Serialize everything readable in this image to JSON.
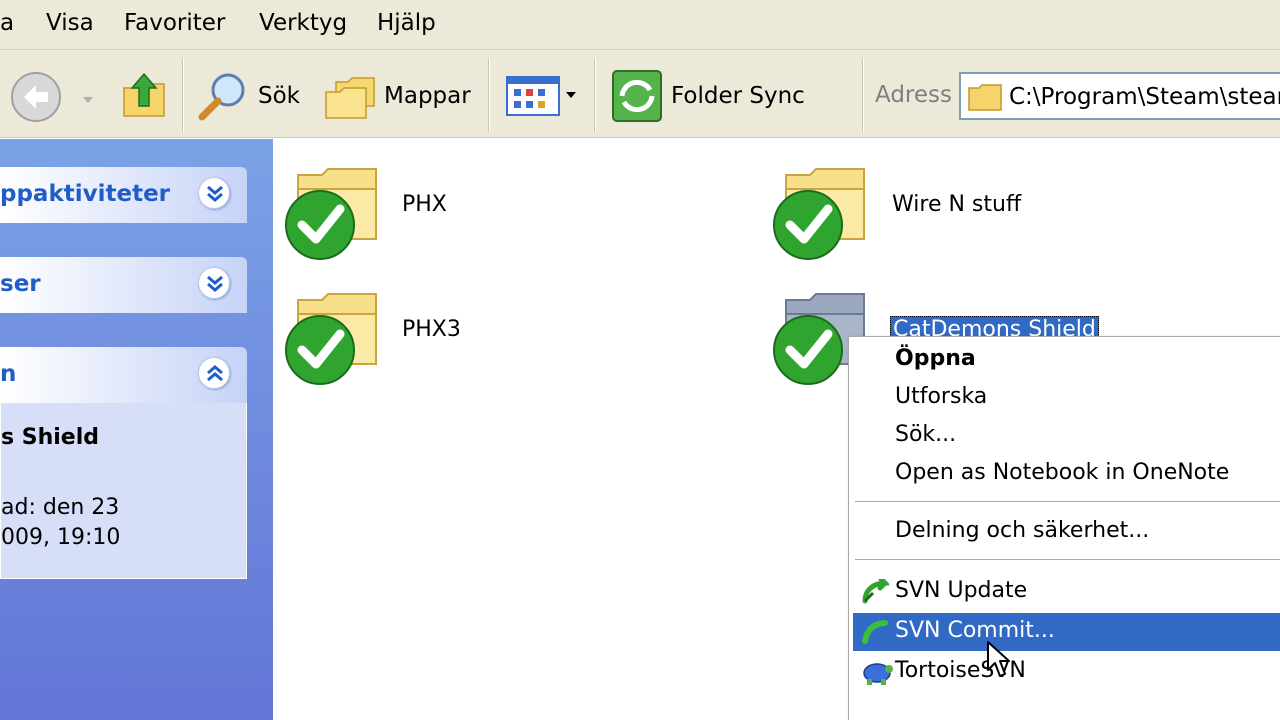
{
  "menubar": {
    "items": [
      "a",
      "Visa",
      "Favoriter",
      "Verktyg",
      "Hjälp"
    ]
  },
  "toolbar": {
    "search_label": "Sök",
    "folders_label": "Mappar",
    "folder_sync_label": "Folder Sync",
    "icons": {
      "back": "back-arrow-icon",
      "up": "up-folder-icon",
      "search": "magnifier-icon",
      "folders": "folders-icon",
      "views": "views-grid-icon",
      "folder_sync": "folder-sync-icon"
    }
  },
  "address": {
    "label": "Adress",
    "value": "C:\\Program\\Steam\\steam"
  },
  "left_pane": {
    "panels": [
      {
        "title": "ppaktiviteter",
        "state": "collapsed"
      },
      {
        "title": "ser",
        "state": "collapsed"
      },
      {
        "title": "n",
        "state": "expanded"
      }
    ],
    "details": {
      "name": "s Shield",
      "line1": "ad: den 23",
      "line2": "009, 19:10"
    }
  },
  "files": [
    {
      "name": "PHX",
      "status": "svn-normal"
    },
    {
      "name": "Wire N stuff",
      "status": "svn-normal"
    },
    {
      "name": "PHX3",
      "status": "svn-normal"
    },
    {
      "name": "CatDemons Shield",
      "status": "svn-normal",
      "selected": true
    }
  ],
  "context_menu": {
    "items": [
      {
        "label": "Öppna",
        "bold": true
      },
      {
        "label": "Utforska"
      },
      {
        "label": "Sök..."
      },
      {
        "label": "Open as Notebook in OneNote"
      },
      {
        "label": "Delning och säkerhet..."
      },
      {
        "label": "SVN Update",
        "icon": "svn-update-icon"
      },
      {
        "label": "SVN Commit...",
        "icon": "svn-commit-icon",
        "highlighted": true
      },
      {
        "label": "TortoiseSVN",
        "icon": "tortoise-icon"
      }
    ]
  },
  "colors": {
    "chrome": "#ece9d8",
    "task_pane": "#6f8de0",
    "panel_title": "#215dc6",
    "selection": "#316ac5",
    "svn_check": "#2fa52f"
  }
}
